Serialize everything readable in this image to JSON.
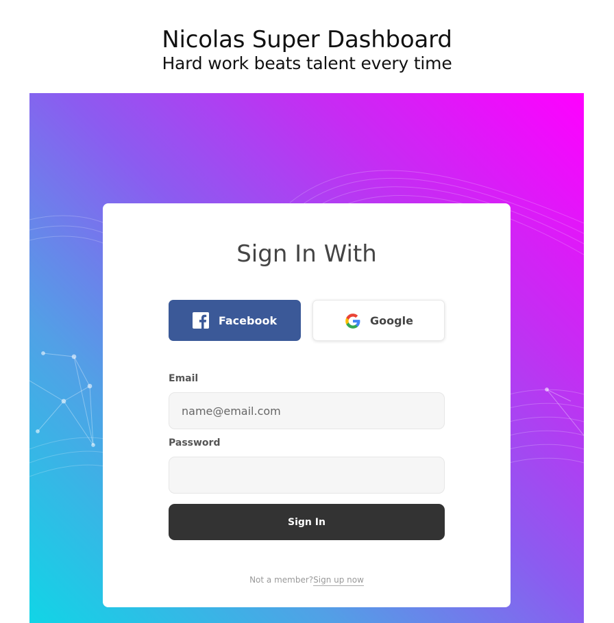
{
  "header": {
    "title": "Nicolas Super Dashboard",
    "subtitle": "Hard work beats talent every time"
  },
  "card": {
    "title": "Sign In With",
    "facebook_label": "Facebook",
    "google_label": "Google",
    "email_label": "Email",
    "email_placeholder": "name@email.com",
    "email_value": "",
    "password_label": "Password",
    "password_value": "",
    "signin_label": "Sign In",
    "footer_text": "Not a member?",
    "signup_link": "Sign up now"
  },
  "icons": {
    "facebook": "facebook-icon",
    "google": "google-icon"
  },
  "colors": {
    "facebook": "#3b5998",
    "button_dark": "#333333",
    "gradient_top_right": "#ff00ff",
    "gradient_bottom_left": "#11d5e6"
  }
}
